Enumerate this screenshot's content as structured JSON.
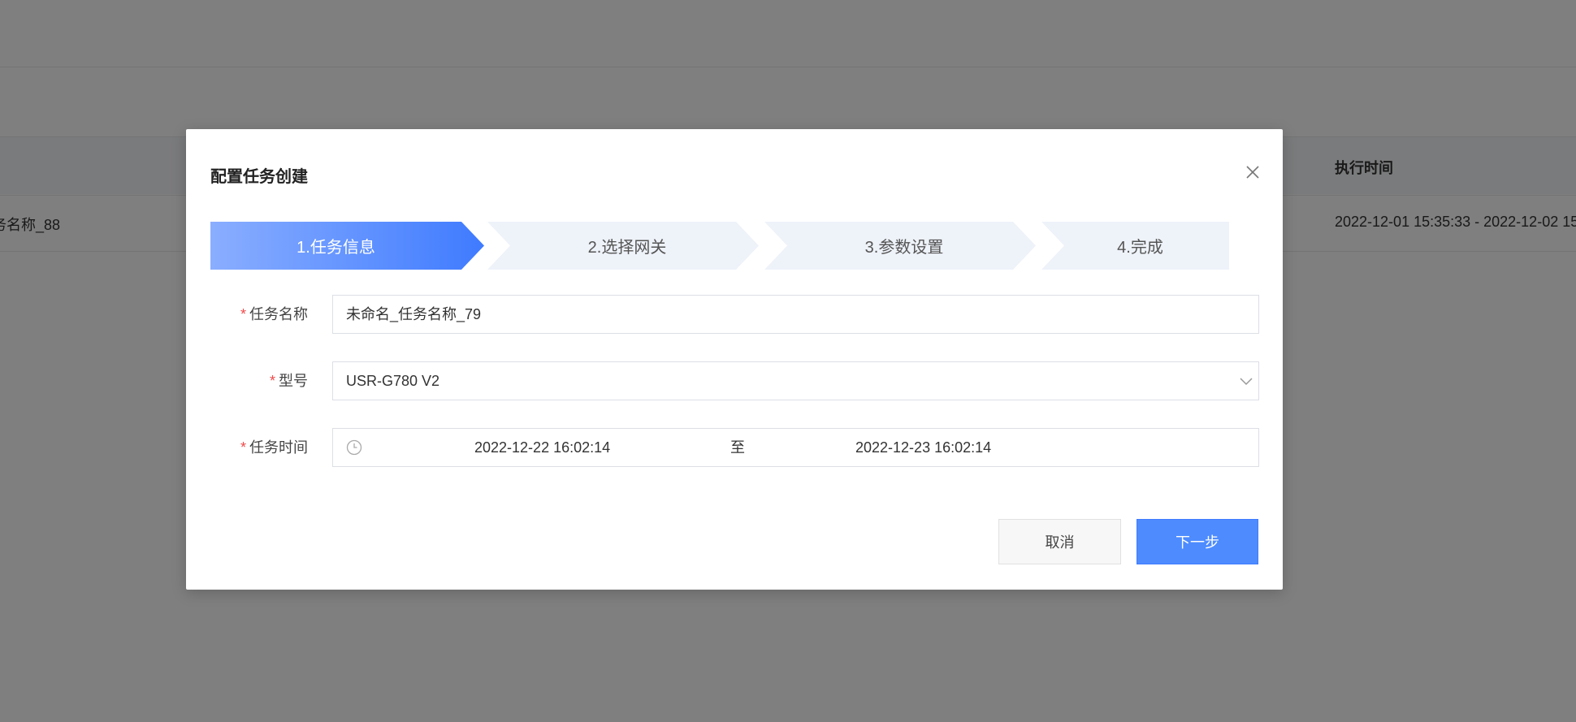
{
  "background": {
    "table_header_time": "执行时间",
    "row_name": "务名称_88",
    "row_time": "2022-12-01 15:35:33 - 2022-12-02 15"
  },
  "modal": {
    "title": "配置任务创建",
    "steps": [
      {
        "label": "1.任务信息",
        "active": true
      },
      {
        "label": "2.选择网关",
        "active": false
      },
      {
        "label": "3.参数设置",
        "active": false
      },
      {
        "label": "4.完成",
        "active": false
      }
    ],
    "form": {
      "task_name": {
        "label": "任务名称",
        "value": "未命名_任务名称_79"
      },
      "model": {
        "label": "型号",
        "value": "USR-G780 V2"
      },
      "task_time": {
        "label": "任务时间",
        "start": "2022-12-22 16:02:14",
        "separator": "至",
        "end": "2022-12-23 16:02:14"
      }
    },
    "buttons": {
      "cancel": "取消",
      "next": "下一步"
    }
  },
  "colors": {
    "primary": "#4d8bff",
    "required": "#f04a4a",
    "step_inactive": "#eef2f9"
  }
}
